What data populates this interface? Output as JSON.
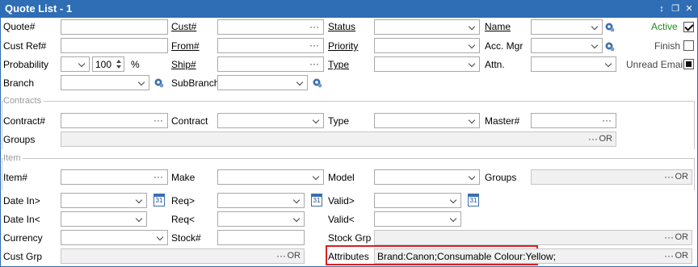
{
  "window": {
    "title": "Quote List - 1"
  },
  "labels": {
    "quote_no": "Quote#",
    "cust_ref": "Cust Ref#",
    "probability": "Probability",
    "branch": "Branch",
    "cust_no": "Cust#",
    "from_no": "From#",
    "ship_no": "Ship#",
    "subbranch": "SubBranch",
    "status": "Status",
    "priority": "Priority",
    "type": "Type",
    "name": "Name",
    "acc_mgr": "Acc. Mgr",
    "attn": "Attn.",
    "active": "Active",
    "finish": "Finish",
    "unread_email": "Unread Email",
    "contracts_section": "Contracts",
    "contract_no": "Contract#",
    "contract": "Contract",
    "contract_type": "Type",
    "master_no": "Master#",
    "groups": "Groups",
    "item_section": "Item",
    "item_no": "Item#",
    "make": "Make",
    "model": "Model",
    "item_groups": "Groups",
    "date_in_gt": "Date In>",
    "date_in_lt": "Date In<",
    "currency": "Currency",
    "cust_grp": "Cust Grp",
    "req_gt": "Req>",
    "req_lt": "Req<",
    "stock_no": "Stock#",
    "valid_gt": "Valid>",
    "valid_lt": "Valid<",
    "stock_grp": "Stock Grp",
    "attributes": "Attributes"
  },
  "values": {
    "probability_pct": "100",
    "percent_sign": "%",
    "attributes": "Brand:Canon;Consumable Colour:Yellow;",
    "active_checked": true,
    "finish_checked": false,
    "unread_email_state": "indeterminate"
  },
  "glyphs": {
    "dots": "···",
    "or": "OR",
    "cal_day": "31"
  }
}
